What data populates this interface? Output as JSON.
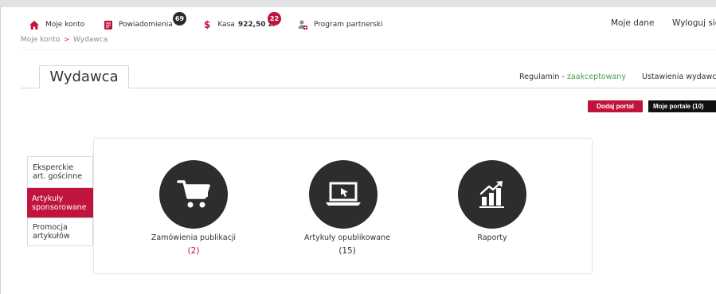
{
  "topbar": {
    "account": {
      "label": "Moje konto",
      "icon": "home-icon"
    },
    "notifications": {
      "label": "Powiadomienia",
      "badge": "69",
      "icon": "notifications-icon"
    },
    "cash": {
      "label": "Kasa",
      "amount": "922,50 zł",
      "badge": "22",
      "icon": "dollar-icon"
    },
    "partner": {
      "label": "Program partnerski",
      "icon": "partner-program-icon"
    },
    "my_data": "Moje dane",
    "logout": "Wyloguj się"
  },
  "breadcrumb": {
    "root": "Moje konto",
    "sep": ">",
    "current": "Wydawca"
  },
  "header": {
    "tab_title": "Wydawca",
    "regulations_label": "Regulamin -",
    "regulations_status": "zaakceptowany",
    "settings_link": "Ustawienia wydawcy"
  },
  "buttons": {
    "add_portal": "Dodaj portal",
    "my_portals": "Moje portale (10)"
  },
  "sidebar": {
    "items": [
      {
        "line1": "Eksperckie",
        "line2": "art. gościnne"
      },
      {
        "line1": "Artykuły",
        "line2": "sponsorowane"
      },
      {
        "line1": "Promocja",
        "line2": "artykułów"
      }
    ]
  },
  "tiles": [
    {
      "label": "Zamówienia publikacji",
      "count": "(2)",
      "icon": "shopping-cart-icon"
    },
    {
      "label": "Artykuły opublikowane",
      "count": "(15)",
      "icon": "laptop-cursor-icon"
    },
    {
      "label": "Raporty",
      "count": "",
      "icon": "chart-growth-icon"
    }
  ],
  "colors": {
    "accent": "#c0143c",
    "success": "#43a34a",
    "dark": "#2d2d2d"
  }
}
